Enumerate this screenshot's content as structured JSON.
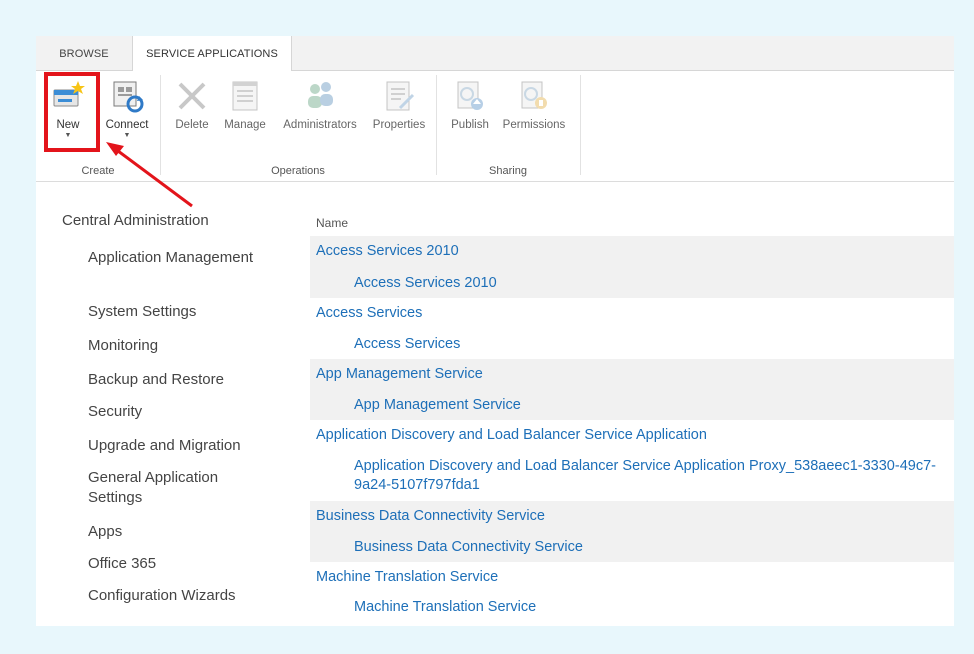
{
  "tabs": {
    "browse": "BROWSE",
    "service_applications": "SERVICE APPLICATIONS"
  },
  "ribbon": {
    "create_group": {
      "label": "Create",
      "new": "New",
      "connect": "Connect"
    },
    "operations_group": {
      "label": "Operations",
      "delete": "Delete",
      "manage": "Manage",
      "administrators": "Administrators",
      "properties": "Properties"
    },
    "sharing_group": {
      "label": "Sharing",
      "publish": "Publish",
      "permissions": "Permissions"
    },
    "caret": "▼"
  },
  "nav": {
    "root": "Central Administration",
    "items": [
      "Application Management",
      "System Settings",
      "Monitoring",
      "Backup and Restore",
      "Security",
      "Upgrade and Migration",
      "General Application Settings",
      "Apps",
      "Office 365",
      "Configuration Wizards"
    ]
  },
  "list": {
    "header": "Name",
    "rows": [
      {
        "text": "Access Services 2010",
        "level": "parent"
      },
      {
        "text": "Access Services 2010",
        "level": "child"
      },
      {
        "text": "Access Services",
        "level": "parent"
      },
      {
        "text": "Access Services",
        "level": "child"
      },
      {
        "text": "App Management Service",
        "level": "parent"
      },
      {
        "text": "App Management Service",
        "level": "child"
      },
      {
        "text": "Application Discovery and Load Balancer Service Application",
        "level": "parent"
      },
      {
        "text": "Application Discovery and Load Balancer Service Application Proxy_538aeec1-3330-49c7-9a24-5107f797fda1",
        "level": "child"
      },
      {
        "text": "Business Data Connectivity Service",
        "level": "parent"
      },
      {
        "text": "Business Data Connectivity Service",
        "level": "child"
      },
      {
        "text": "Machine Translation Service",
        "level": "parent"
      },
      {
        "text": "Machine Translation Service",
        "level": "child"
      }
    ]
  },
  "colors": {
    "link": "#1d6fb8",
    "highlight": "#e3141b",
    "page_bg": "#e8f7fc"
  }
}
